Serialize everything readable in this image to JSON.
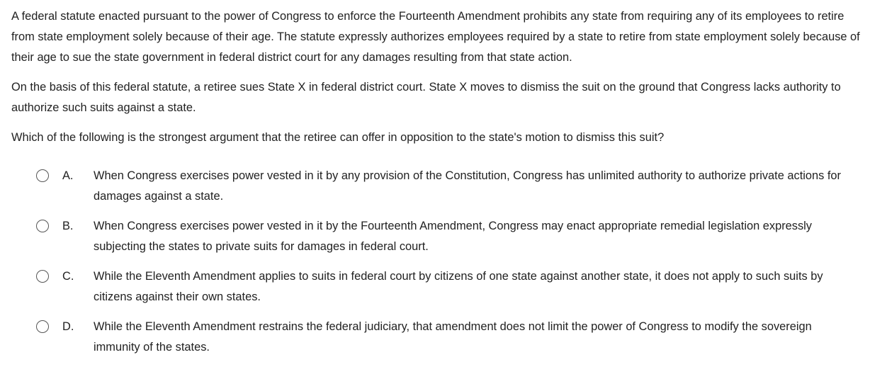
{
  "stem": {
    "paragraph_1": "A federal statute enacted pursuant to the power of Congress to enforce the Fourteenth Amendment prohibits any state from requiring any of its employees to retire from state employment solely because of their age.  The statute expressly authorizes employees required by a state to retire from state employment solely because of their age to sue the state government in federal district court for any damages resulting from that state action.",
    "paragraph_2": "On the basis of this federal statute, a retiree sues State X in federal district court.  State X moves to dismiss the suit on the ground that Congress lacks authority to authorize such suits against a state.",
    "question": "Which of the following is the strongest argument that the retiree can offer in opposition to the state's motion to dismiss this suit?"
  },
  "options": [
    {
      "letter": "A.",
      "text": "When Congress exercises power vested in it by any provision of the Constitution, Congress has unlimited authority to authorize private actions for damages against a state."
    },
    {
      "letter": "B.",
      "text": "When Congress exercises power vested in it by the Fourteenth Amendment, Congress may enact appropriate remedial legislation expressly subjecting the states to private suits for damages in federal court."
    },
    {
      "letter": "C.",
      "text": "While the Eleventh Amendment applies to suits in federal court by citizens of one state against another state, it does not apply to such suits by citizens against their own states."
    },
    {
      "letter": "D.",
      "text": "While the Eleventh Amendment restrains the federal judiciary, that amendment does not limit the power of Congress to modify the sovereign immunity of the states."
    }
  ]
}
